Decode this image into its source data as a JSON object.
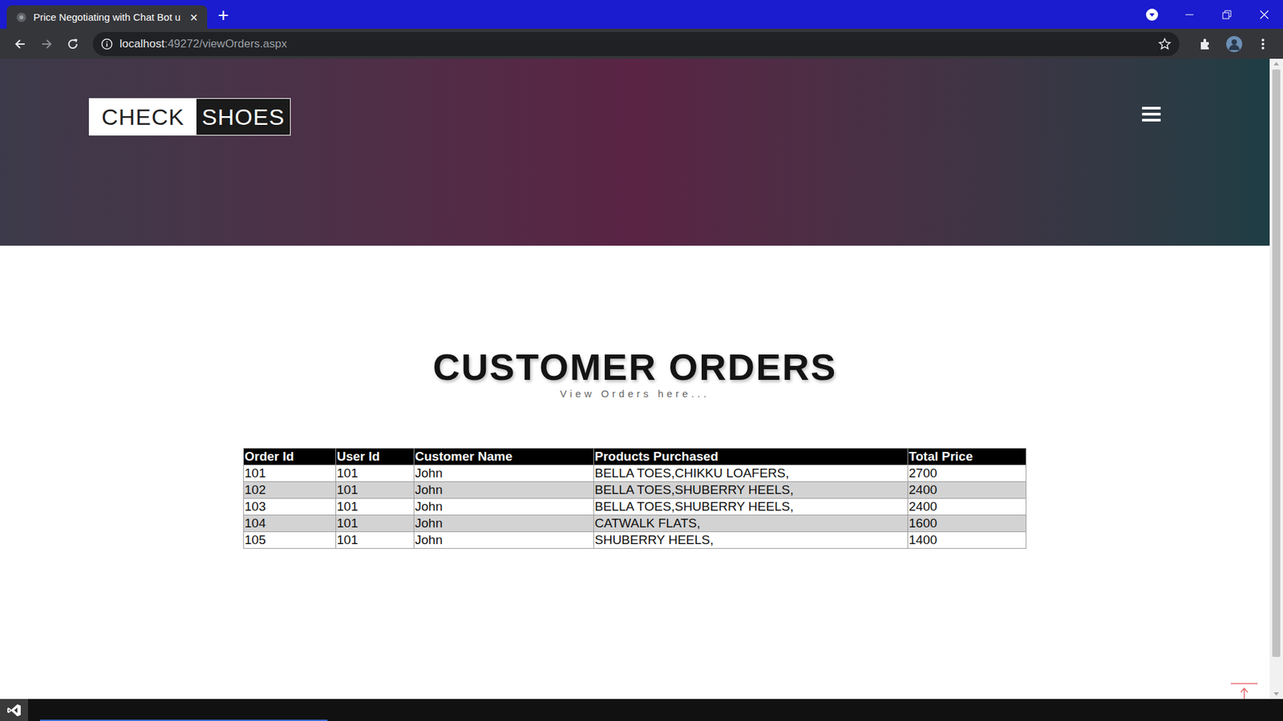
{
  "browser": {
    "tab": {
      "label": "Price Negotiating with Chat Bot u",
      "close": "×",
      "selected": true
    },
    "new_tab": "+",
    "address": {
      "host": "localhost",
      "path": ":49272/viewOrders.aspx"
    }
  },
  "site": {
    "logo": [
      "CHECK",
      "SHOES"
    ]
  },
  "page": {
    "heading": "CUSTOMER ORDERS",
    "subtitle": "View Orders here..."
  },
  "table": {
    "columns": [
      "Order Id",
      "User Id",
      "Customer Name",
      "Products Purchased",
      "Total Price"
    ],
    "rows": [
      [
        "101",
        "101",
        "John",
        "BELLA TOES,CHIKKU LOAFERS,",
        "2700"
      ],
      [
        "102",
        "101",
        "John",
        "BELLA TOES,SHUBERRY HEELS,",
        "2400"
      ],
      [
        "103",
        "101",
        "John",
        "BELLA TOES,SHUBERRY HEELS,",
        "2400"
      ],
      [
        "104",
        "101",
        "John",
        "CATWALK FLATS,",
        "1600"
      ],
      [
        "105",
        "101",
        "John",
        "SHUBERRY HEELS,",
        "1400"
      ]
    ]
  }
}
